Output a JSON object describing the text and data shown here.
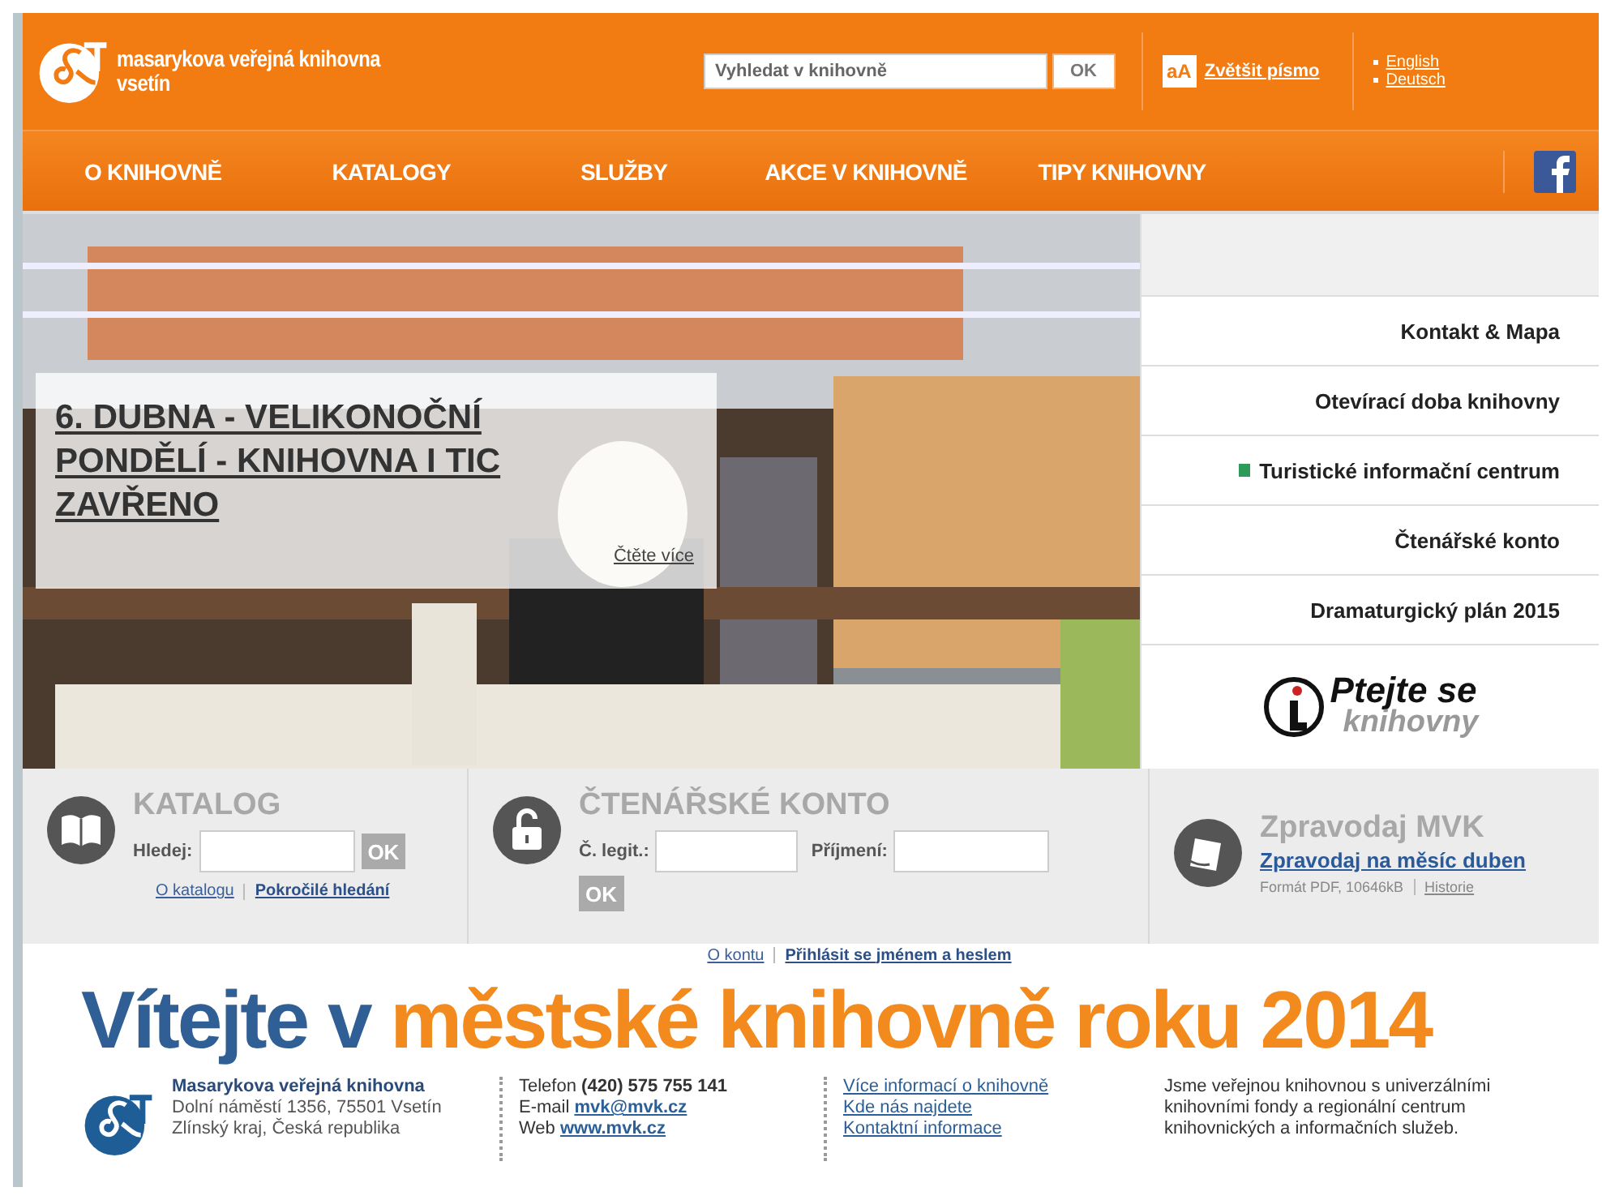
{
  "header": {
    "logo_text": [
      "masarykova veřejná knihovna",
      "vsetín"
    ],
    "search": {
      "placeholder": "Vyhledat v knihovně",
      "button": "OK"
    },
    "font_size": {
      "icon_label": "aA",
      "link": "Zvětšit písmo"
    },
    "languages": [
      "English",
      "Deutsch"
    ]
  },
  "nav": {
    "items": [
      "O KNIHOVNĚ",
      "KATALOGY",
      "SLUŽBY",
      "AKCE V KNIHOVNĚ",
      "TIPY KNIHOVNY"
    ]
  },
  "hero": {
    "headline": "6. DUBNA - VELIKONOČNÍ PONDĚLÍ - KNIHOVNA I TIC ZAVŘENO",
    "more": "Čtěte více"
  },
  "side_menu": {
    "items": [
      {
        "label": "Kontakt & Mapa",
        "kind": "link"
      },
      {
        "label": "Otevírací doba knihovny",
        "kind": "link"
      },
      {
        "label": "Turistické informační centrum",
        "kind": "badge",
        "color": "#2e9a5a"
      },
      {
        "label": "Čtenářské konto",
        "kind": "link"
      },
      {
        "label": "Dramaturgický plán 2015",
        "kind": "link"
      }
    ],
    "ask": {
      "title": "Ptejte se",
      "subtitle": "knihovny"
    }
  },
  "catalog": {
    "title": "KATALOG",
    "label": "Hledej:",
    "button": "OK",
    "links": [
      "O katalogu",
      "Pokročilé hledání"
    ]
  },
  "account": {
    "title": "ČTENÁŘSKÉ KONTO",
    "fields": [
      "Č. legit.:",
      "Příjmení:"
    ],
    "button": "OK",
    "links": [
      "O kontu",
      "Přihlásit se jménem a heslem"
    ]
  },
  "newsletter": {
    "title": "Zpravodaj MVK",
    "link": "Zpravodaj na měsíc duben",
    "info": "Formát PDF, 10646kB",
    "history": "Historie"
  },
  "welcome": {
    "lead": "Vítejte v",
    "rest": "městské knihovně roku 2014"
  },
  "footer": {
    "org": {
      "name": "Masarykova veřejná knihovna",
      "lines": [
        "Dolní náměstí 1356, 75501 Vsetín",
        "Zlínský kraj, Česká republika"
      ]
    },
    "contact": [
      {
        "label": "Telefon",
        "value": "(420) 575 755 141",
        "kind": "text"
      },
      {
        "label": "E-mail",
        "value": "mvk@mvk.cz",
        "kind": "link"
      },
      {
        "label": "Web",
        "value": "www.mvk.cz",
        "kind": "link"
      }
    ],
    "links": [
      "Více informací o knihovně",
      "Kde nás najdete",
      "Kontaktní informace"
    ],
    "about": "Jsme veřejnou knihovnou s univerzálními knihovními fondy a regionální centrum knihovnických a informačních služeb."
  }
}
